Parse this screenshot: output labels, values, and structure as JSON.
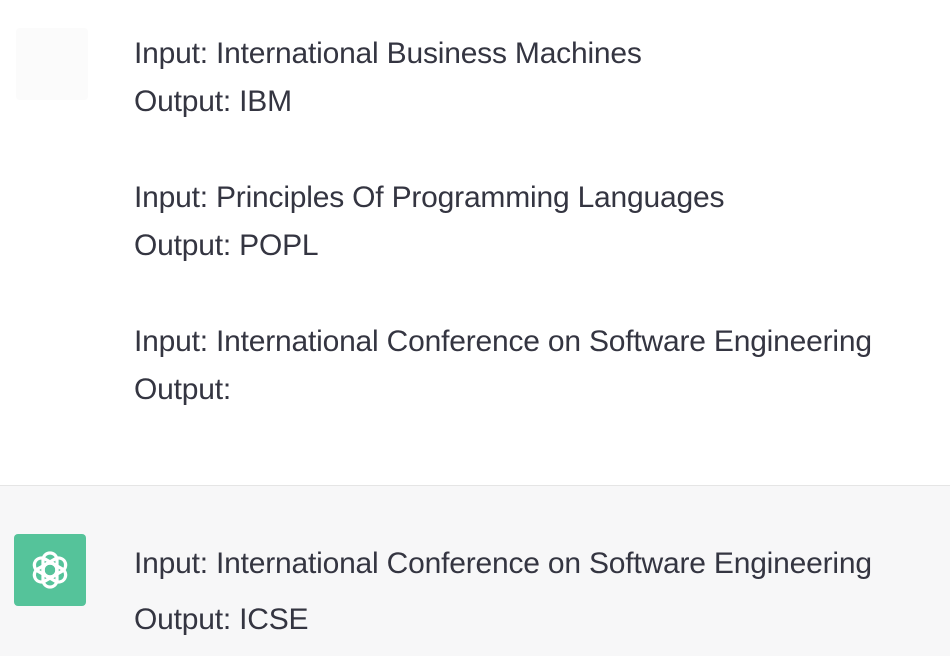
{
  "colors": {
    "text": "#343541",
    "assistant_bg": "#f7f7f8",
    "assistant_avatar_bg": "#55c39a",
    "divider": "#e5e5e5"
  },
  "user_message": {
    "avatar_icon": "user-avatar-icon",
    "examples": [
      {
        "input": "Input: International Business Machines",
        "output": "Output: IBM"
      },
      {
        "input": "Input: Principles Of Programming Languages",
        "output": "Output: POPL"
      },
      {
        "input": "Input: International Conference on Software Engineering",
        "output": "Output:"
      }
    ]
  },
  "assistant_message": {
    "avatar_icon": "openai-logo-icon",
    "input": "Input: International Conference on Software Engineering",
    "output": "Output: ICSE"
  }
}
